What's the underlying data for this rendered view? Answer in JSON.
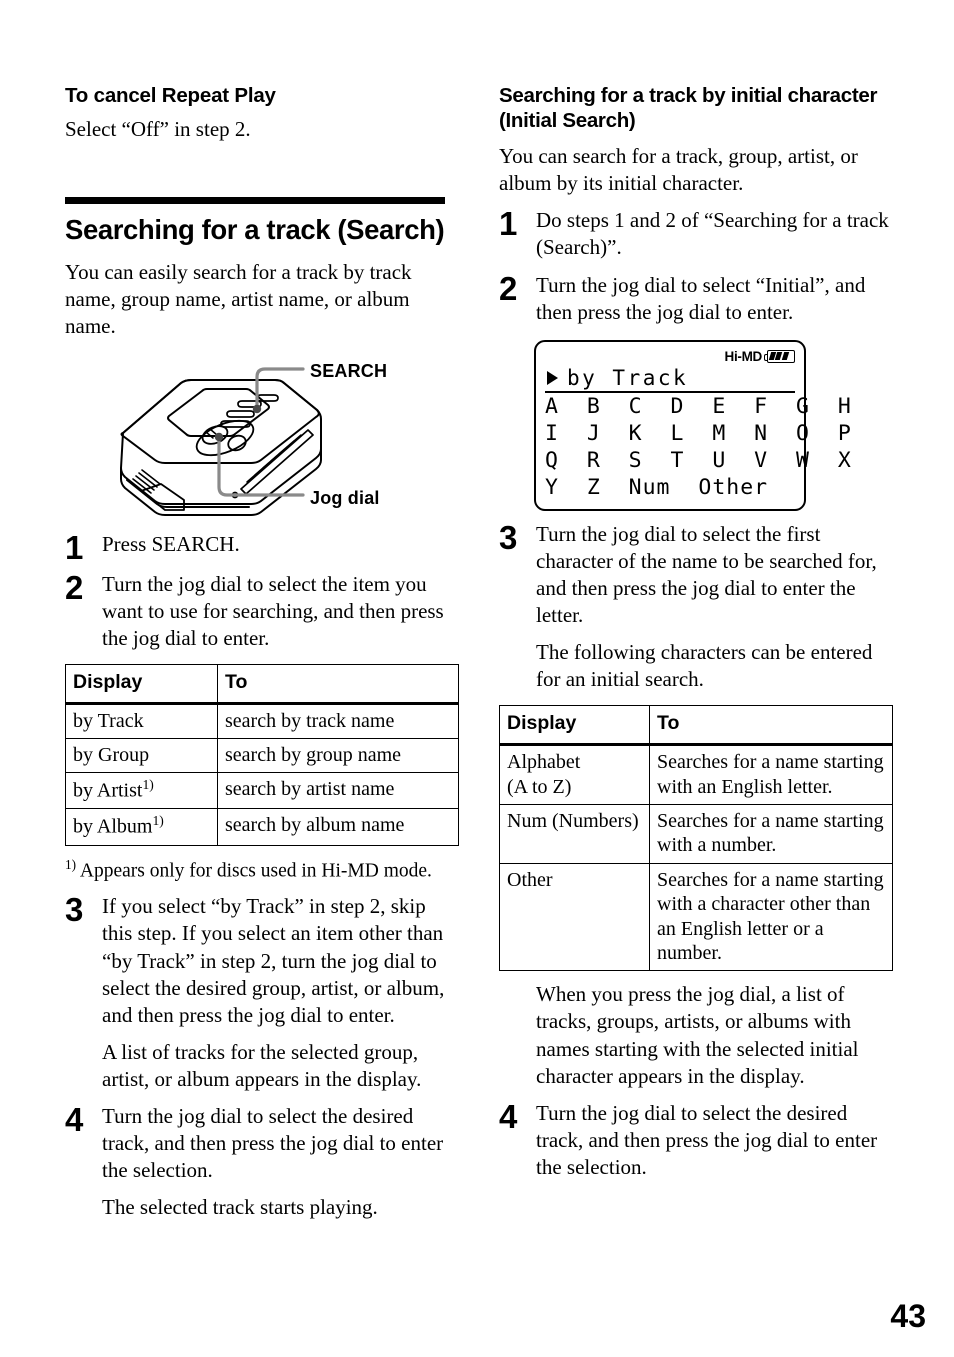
{
  "page": {
    "number": "43"
  },
  "left_column": {
    "cancel_section": {
      "heading": "To cancel Repeat Play",
      "body": "Select “Off” in step 2."
    },
    "main_section": {
      "heading": "Searching for a track (Search)",
      "intro": "You can easily search for a track by track name, group name, artist name, or album name.",
      "figure": {
        "callouts": [
          {
            "label": "SEARCH"
          },
          {
            "label": "Jog dial"
          }
        ]
      },
      "steps": [
        {
          "num": "1",
          "paragraphs": [
            "Press SEARCH."
          ]
        },
        {
          "num": "2",
          "paragraphs": [
            "Turn the jog dial to select the item you want to use for searching, and then press the jog dial to enter."
          ]
        },
        {
          "num": "3",
          "paragraphs": [
            "If you select “by Track” in step 2, skip this step. If you select an item other than “by Track” in step 2, turn the jog dial to select the desired group, artist, or album, and then press the jog dial to enter.",
            "A list of tracks for the selected group, artist, or album appears in the display."
          ]
        },
        {
          "num": "4",
          "paragraphs": [
            "Turn the jog dial to select the desired track, and then press the jog dial to enter the selection.",
            "The selected track starts playing."
          ]
        }
      ],
      "table": {
        "headers": [
          "Display",
          "To"
        ],
        "rows": [
          {
            "display": "by Track",
            "footnote": "",
            "to": "search by track name"
          },
          {
            "display": "by Group",
            "footnote": "",
            "to": "search by group name"
          },
          {
            "display": "by Artist",
            "footnote": "1)",
            "to": "search by artist name"
          },
          {
            "display": "by Album",
            "footnote": "1)",
            "to": "search by album name"
          }
        ]
      },
      "footnote": {
        "marker": "1)",
        "text": "Appears only for discs used in Hi-MD mode."
      }
    }
  },
  "right_column": {
    "heading": "Searching for a track by initial character (Initial Search)",
    "intro": "You can search for a track, group, artist, or album by its initial character.",
    "steps": [
      {
        "num": "1",
        "paragraphs": [
          "Do steps 1 and 2 of “Searching for a track (Search)”."
        ]
      },
      {
        "num": "2",
        "paragraphs": [
          "Turn the jog dial to select “Initial”, and then press the jog dial to enter."
        ]
      },
      {
        "num": "3",
        "paragraphs": [
          "Turn the jog dial to select the first character of the name to be searched for, and then press the jog dial to enter the letter.",
          "The following characters can be entered for an initial search."
        ]
      },
      {
        "num": "4",
        "paragraphs": [
          "Turn the jog dial to select the desired track, and then press the jog dial to enter the selection."
        ]
      }
    ],
    "lcd": {
      "mode_label": "Hi-MD",
      "battery_bars": 3,
      "selected_item": "by Track",
      "grid_rows": [
        "A  B  C  D  E  F  G  H",
        "I  J  K  L  M  N  O  P",
        "Q  R  S  T  U  V  W  X",
        "Y  Z  Num  Other"
      ]
    },
    "table": {
      "headers": [
        "Display",
        "To"
      ],
      "rows": [
        {
          "display": "Alphabet\n(A to Z)",
          "to": "Searches for a name starting with an English letter."
        },
        {
          "display": "Num (Numbers)",
          "to": "Searches for a name starting with a number."
        },
        {
          "display": "Other",
          "to": "Searches for a name starting with a character other than an English letter or a number."
        }
      ]
    },
    "after_table_note": "When you press the jog dial, a list of tracks, groups, artists, or albums with names starting with the selected initial character appears in the display."
  }
}
